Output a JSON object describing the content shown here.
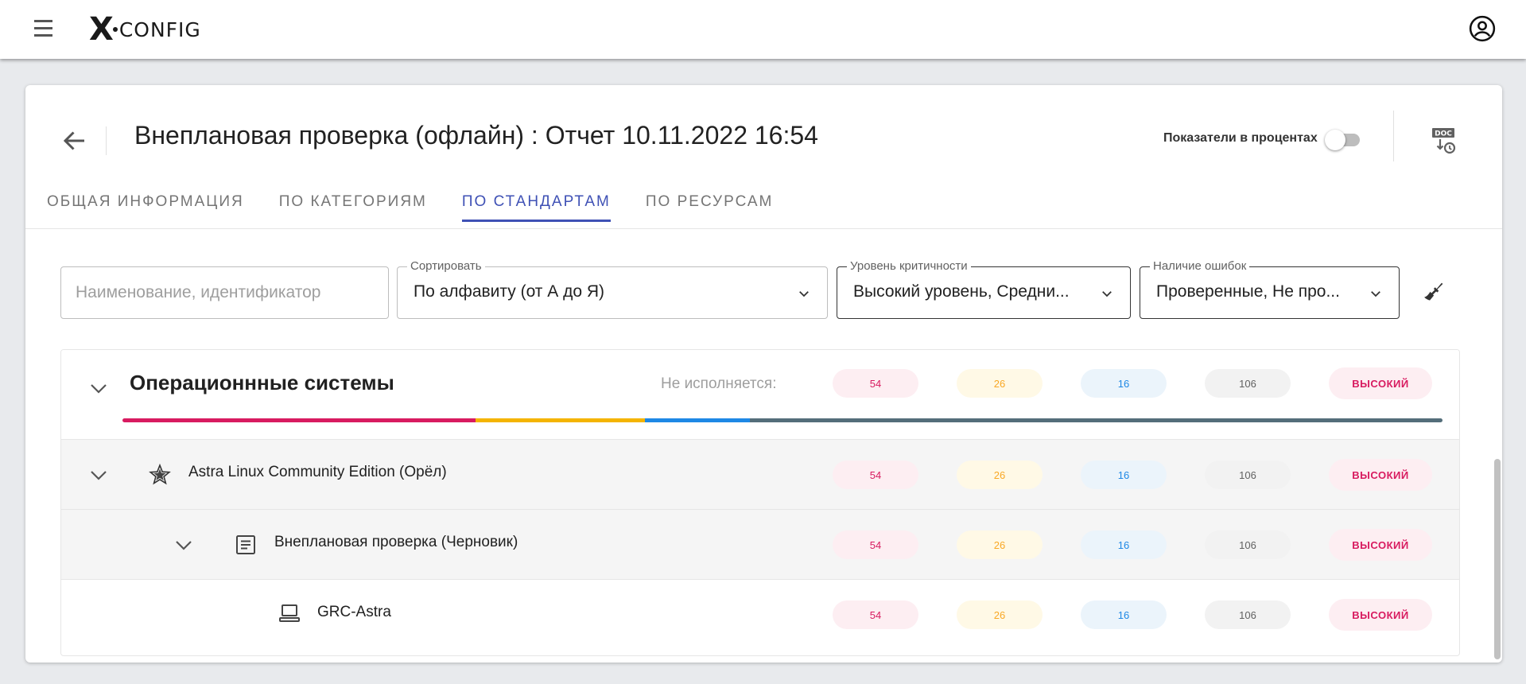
{
  "app": {
    "logo_x": "X",
    "logo_text": "CONFIG"
  },
  "header": {
    "title": "Внеплановая проверка (офлайн) : Отчет 10.11.2022 16:54",
    "percent_label": "Показатели в процентах",
    "percent_toggle_on": false
  },
  "tabs": [
    {
      "label": "ОБЩАЯ ИНФОРМАЦИЯ",
      "active": false
    },
    {
      "label": "ПО КАТЕГОРИЯМ",
      "active": false
    },
    {
      "label": "ПО СТАНДАРТАМ",
      "active": true
    },
    {
      "label": "ПО РЕСУРСАМ",
      "active": false
    }
  ],
  "filters": {
    "search": {
      "placeholder": "Наименование, идентификатор",
      "value": ""
    },
    "sort": {
      "label": "Сортировать",
      "value": "По алфавиту (от А до Я)"
    },
    "criticality": {
      "label": "Уровень критичности",
      "value": "Высокий уровень, Средни..."
    },
    "errors": {
      "label": "Наличие ошибок",
      "value": "Проверенные, Не про..."
    }
  },
  "group": {
    "title": "Операционнные системы",
    "status_label": "Не исполняется:",
    "counts": {
      "high": "54",
      "medium": "26",
      "low": "16",
      "total": "106"
    },
    "level": "ВЫСОКИЙ",
    "progress": [
      {
        "name": "high",
        "fraction": 0.2673,
        "color": "#d81b60"
      },
      {
        "name": "medium",
        "fraction": 0.1287,
        "color": "#f4b400"
      },
      {
        "name": "low",
        "fraction": 0.0792,
        "color": "#1e88e5"
      },
      {
        "name": "rest",
        "fraction": 0.5248,
        "color": "#546e7a"
      }
    ]
  },
  "rows": [
    {
      "label": "Astra Linux Community Edition (Орёл)",
      "icon": "astra-star-icon",
      "counts": {
        "high": "54",
        "medium": "26",
        "low": "16",
        "total": "106"
      },
      "level": "ВЫСОКИЙ"
    },
    {
      "label": "Внеплановая проверка (Черновик)",
      "icon": "document-icon",
      "counts": {
        "high": "54",
        "medium": "26",
        "low": "16",
        "total": "106"
      },
      "level": "ВЫСОКИЙ"
    },
    {
      "label": "GRC-Astra",
      "icon": "laptop-icon",
      "counts": {
        "high": "54",
        "medium": "26",
        "low": "16",
        "total": "106"
      },
      "level": "ВЫСОКИЙ"
    }
  ],
  "colors": {
    "accent": "#3f51b5",
    "high": "#d81b60",
    "medium": "#f9a825",
    "low": "#1e88e5",
    "neutral": "#616161"
  }
}
